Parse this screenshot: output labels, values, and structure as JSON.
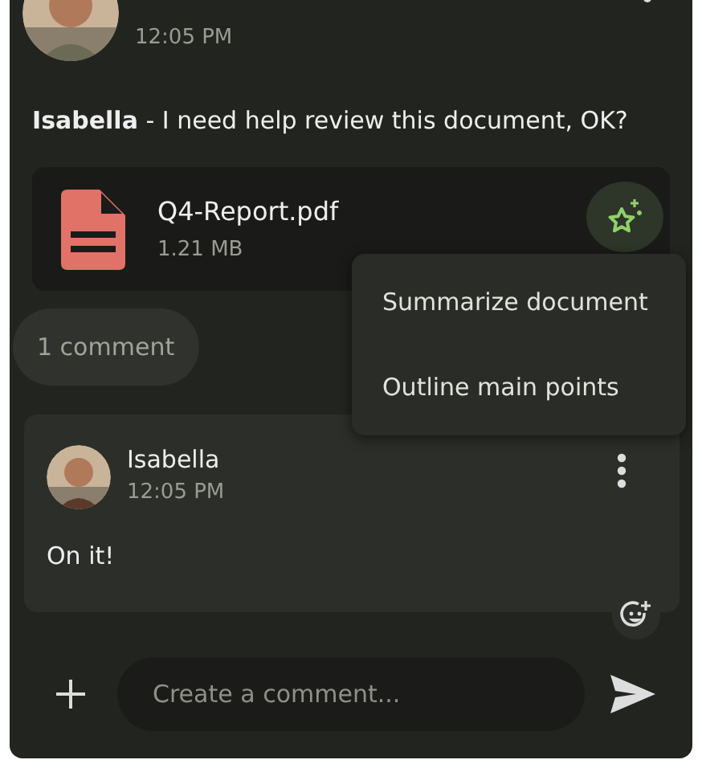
{
  "post": {
    "time": "12:05 PM",
    "message": "**Isabella** - I need help review this document, OK?"
  },
  "attachment": {
    "name": "Q4-Report.pdf",
    "size": "1.21 MB"
  },
  "ai_menu": {
    "open": true,
    "items": [
      "Summarize document",
      "Outline main points"
    ]
  },
  "comment_count": "1 comment",
  "comments": [
    {
      "author": "Isabella",
      "time": "12:05 PM",
      "text": "On it!"
    }
  ],
  "composer": {
    "placeholder": "Create a comment..."
  }
}
